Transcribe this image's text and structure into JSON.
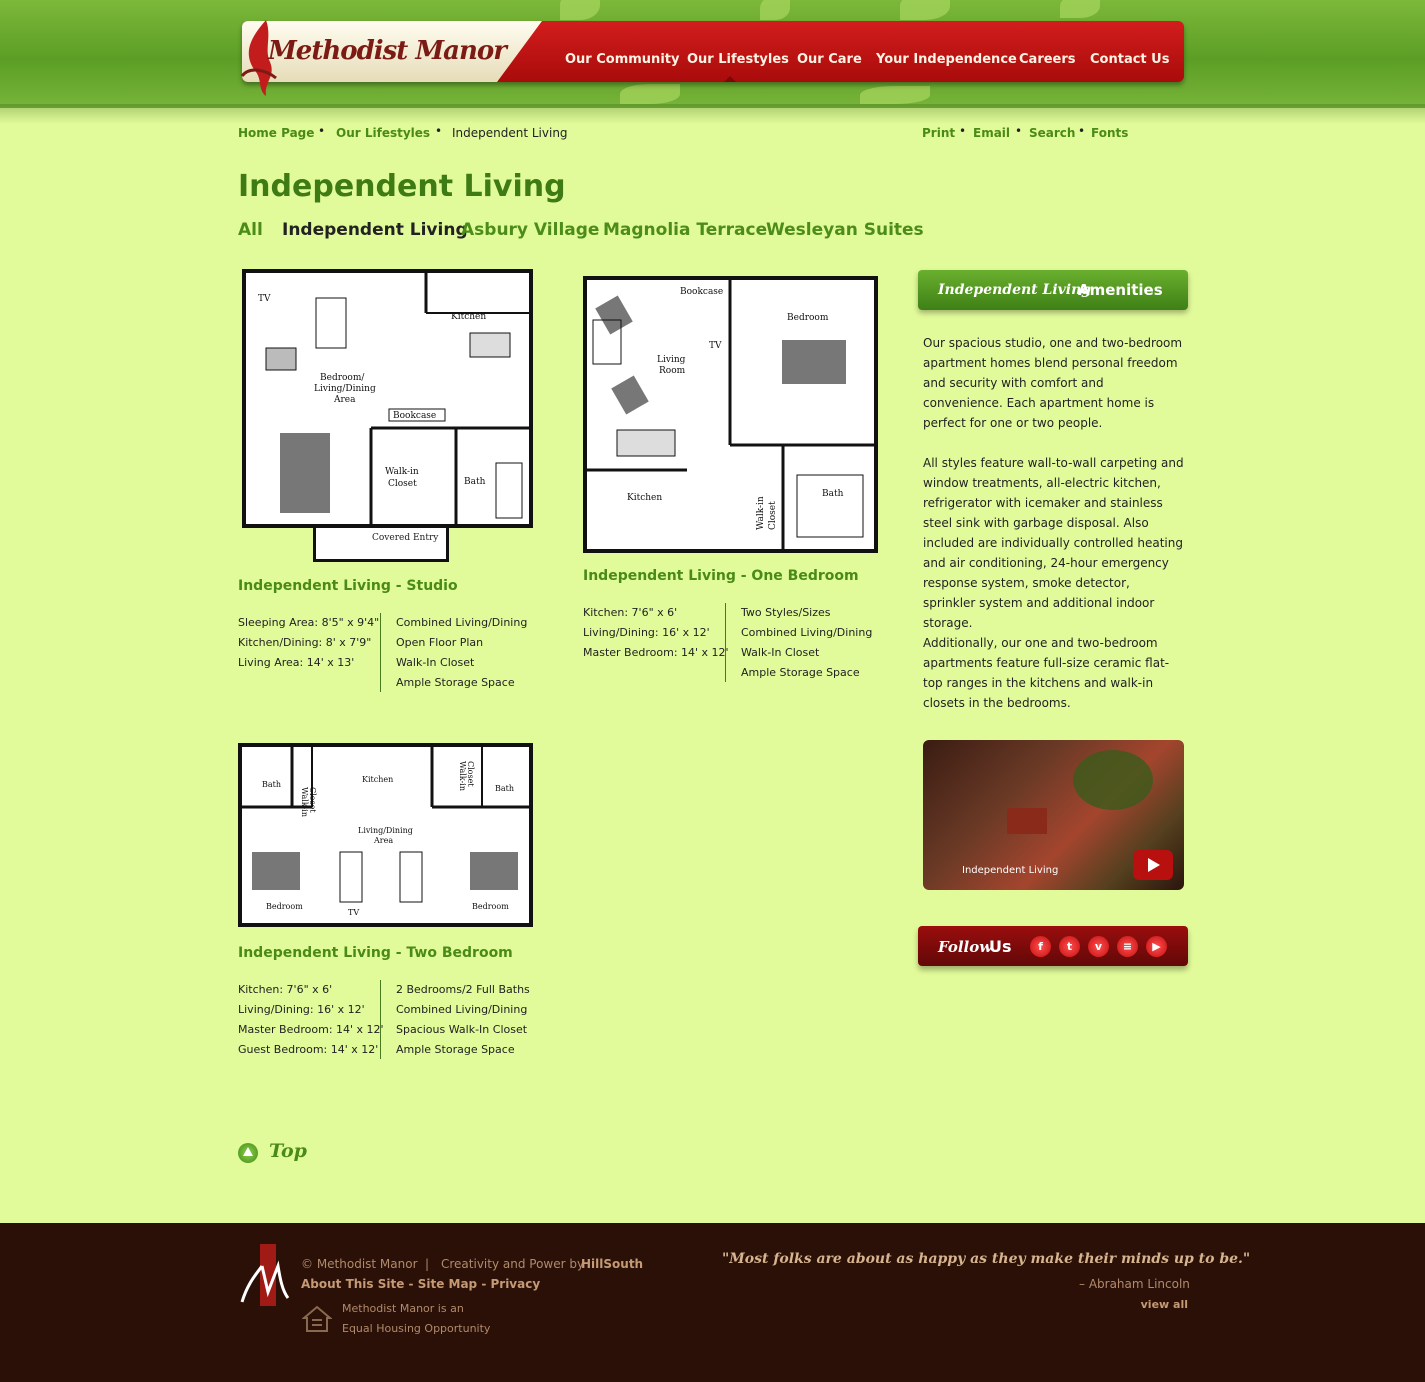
{
  "header": {
    "logo_text": "Methodist Manor",
    "nav": [
      {
        "label": "Our Community"
      },
      {
        "label": "Our Lifestyles"
      },
      {
        "label": "Our Care"
      },
      {
        "label": "Your Independence"
      },
      {
        "label": "Careers"
      },
      {
        "label": "Contact Us"
      }
    ]
  },
  "breadcrumb": {
    "items": [
      "Home Page",
      "Our Lifestyles",
      "Independent Living"
    ]
  },
  "utilities": [
    "Print",
    "Email",
    "Search",
    "Fonts"
  ],
  "page": {
    "title": "Independent Living",
    "tabs": [
      "All",
      "Independent Living",
      "Asbury Village",
      "Magnolia Terrace",
      "Wesleyan Suites"
    ]
  },
  "plans": {
    "studio": {
      "title": "Independent Living - Studio",
      "rooms": [
        "TV",
        "Kitchen",
        "Bedroom/",
        "Living/Dining",
        "Area",
        "Bookcase",
        "Walk-in",
        "Closet",
        "Bath",
        "Covered Entry"
      ],
      "dims": [
        "Sleeping Area: 8'5\" x 9'4\"",
        "Kitchen/Dining: 8' x 7'9\"",
        "Living Area: 14' x 13'"
      ],
      "features": [
        "Combined Living/Dining",
        "Open Floor Plan",
        "Walk-In Closet",
        "Ample Storage Space"
      ]
    },
    "one_bed": {
      "title": "Independent Living - One Bedroom",
      "rooms": [
        "Bookcase",
        "Bedroom",
        "Living",
        "Room",
        "TV",
        "Kitchen",
        "Bath",
        "Walk-in",
        "Closet"
      ],
      "dims": [
        "Kitchen: 7'6\" x 6'",
        "Living/Dining: 16' x 12'",
        "Master Bedroom: 14' x 12'"
      ],
      "features": [
        "Two Styles/Sizes",
        "Combined Living/Dining",
        "Walk-In Closet",
        "Ample Storage Space"
      ]
    },
    "two_bed": {
      "title": "Independent Living - Two Bedroom",
      "rooms": [
        "Bath",
        "Walk-in",
        "Closet",
        "Kitchen",
        "Walk-in",
        "Closet",
        "Bath",
        "Living/Dining",
        "Area",
        "Bedroom",
        "Bedroom",
        "TV"
      ],
      "dims": [
        "Kitchen: 7'6\" x 6'",
        "Living/Dining: 16' x 12'",
        "Master Bedroom: 14' x 12'",
        "Guest Bedroom: 14' x 12'"
      ],
      "features": [
        "2 Bedrooms/2 Full Baths",
        "Combined Living/Dining",
        "Spacious Walk-In Closet",
        "Ample Storage Space"
      ]
    }
  },
  "sidebar": {
    "amenities_em": "Independent Living",
    "amenities_rest": "Amenities",
    "paragraphs": [
      "Our spacious studio, one and two-bedroom apartment homes blend personal freedom and security with comfort and convenience. Each apartment home is perfect for one or two people.",
      "All styles feature wall-to-wall carpeting and window treatments, all-electric kitchen, refrigerator with icemaker and stainless steel sink with garbage disposal. Also included are individually controlled heating and air conditioning, 24-hour emergency response system, smoke detector, sprinkler system and additional indoor storage.",
      "Additionally, our one and two-bedroom apartments feature full-size ceramic flat-top ranges in the kitchens and walk-in closets in the bedrooms."
    ],
    "video_label": "Independent Living",
    "follow_em": "Follow",
    "follow_rest": "Us",
    "social": [
      {
        "icon": "facebook-icon",
        "glyph": "f"
      },
      {
        "icon": "twitter-icon",
        "glyph": "t"
      },
      {
        "icon": "vimeo-icon",
        "glyph": "v"
      },
      {
        "icon": "rss-icon",
        "glyph": "≡"
      },
      {
        "icon": "youtube-icon",
        "glyph": "▶"
      }
    ]
  },
  "top_link": "Top",
  "footer": {
    "copyright": "© Methodist Manor",
    "sep": "|",
    "credit": "Creativity and Power by",
    "credit_brand": "HillSouth",
    "links": "About This Site - Site Map - Privacy",
    "eho_line1": "Methodist Manor is an",
    "eho_line2": "Equal Housing Opportunity",
    "quote": "\"Most folks are about as happy as they make their minds up to be.\"",
    "author": "– Abraham Lincoln",
    "view_all": "view all"
  },
  "colors": {
    "accent_green": "#4a8a17",
    "nav_red": "#b80f0f",
    "footer_brown": "#2a1007",
    "page_bg": "#e2fb9a"
  }
}
